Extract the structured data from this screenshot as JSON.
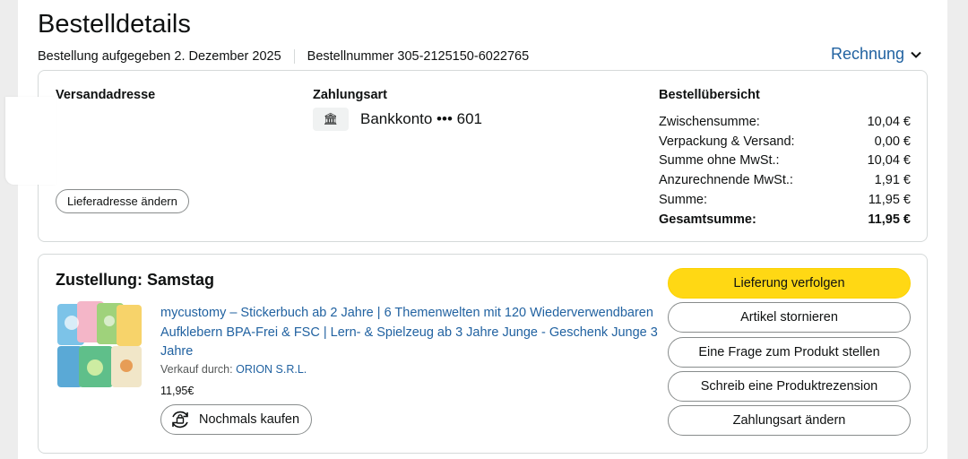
{
  "header": {
    "title": "Bestelldetails",
    "order_date": "Bestellung aufgegeben 2. Dezember 2025",
    "order_number": "Bestellnummer 305-2125150-6022765",
    "invoice_label": "Rechnung"
  },
  "shipping": {
    "heading": "Versandadresse",
    "change_button": "Lieferadresse ändern"
  },
  "payment": {
    "heading": "Zahlungsart",
    "method": "Bankkonto ••• 601"
  },
  "summary": {
    "heading": "Bestellübersicht",
    "rows": [
      {
        "label": "Zwischensumme:",
        "value": "10,04 €"
      },
      {
        "label": "Verpackung & Versand:",
        "value": "0,00 €"
      },
      {
        "label": "Summe ohne MwSt.:",
        "value": "10,04 €"
      },
      {
        "label": "Anzurechnende MwSt.:",
        "value": "1,91 €"
      },
      {
        "label": "Summe:",
        "value": "11,95 €"
      },
      {
        "label": "Gesamtsumme:",
        "value": "11,95 €"
      }
    ]
  },
  "delivery": {
    "heading": "Zustellung: Samstag",
    "product_title": "mycustomy – Stickerbuch ab 2 Jahre | 6 Themenwelten mit 120 Wiederverwendbaren Aufklebern BPA-Frei & FSC | Lern- & Spielzeug ab 3 Jahre Junge - Geschenk Junge 3 Jahre",
    "seller_prefix": "Verkauf durch:",
    "seller_name": "ORION S.R.L.",
    "price": "11,95€",
    "rebuy_label": "Nochmals kaufen"
  },
  "actions": [
    "Lieferung verfolgen",
    "Artikel stornieren",
    "Eine Frage zum Produkt stellen",
    "Schreib eine Produktrezension",
    "Zahlungsart ändern"
  ],
  "colors": {
    "link": "#2162a1",
    "primary_button": "#ffd814",
    "border": "#d5d9d9"
  }
}
